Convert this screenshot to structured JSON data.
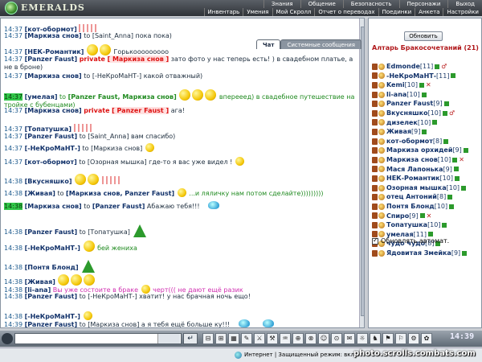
{
  "app": {
    "logo_text": "EMERALDS"
  },
  "nav": {
    "row1": [
      "Знания",
      "Общение",
      "Безопасность",
      "Персонажи",
      "Выход"
    ],
    "row2": [
      "Инвентарь",
      "Умения",
      "Мой Скролл",
      "Отчет о переводах",
      "Поединки",
      "Анкета",
      "Настройки"
    ]
  },
  "tabs": [
    {
      "label": "Чат",
      "active": true
    },
    {
      "label": "Системные сообщения",
      "active": false
    }
  ],
  "messages": [
    {
      "time": "14:37",
      "nick": "[кот-обормот]",
      "text": ""
    },
    {
      "time": "14:37",
      "nick": "[Маркиза снов]",
      "to_prefix": "to",
      "to": "[Saint_Anna]",
      "text": "пока пока)"
    },
    {
      "time": "14:37",
      "nick": "[НЕК-Романтик]",
      "text": "Горькооооооооо"
    },
    {
      "time": "14:37",
      "nick": "[Panzer Faust]",
      "priv": "private",
      "privnick": "[ Маркиза снов ]",
      "text": "зато фото у нас теперь есть! ) в свадебном платье, а не в броне)"
    },
    {
      "time": "14:37",
      "nick": "[Маркиза снов]",
      "to_prefix": "to",
      "to": "[-НеКроМаНТ-]",
      "text": "какой отважный)"
    },
    {
      "time": "14:37",
      "nick": "[умелая]",
      "to_prefix": "to",
      "to": "[Panzer Faust, Маркиза снов]",
      "text": "вперееед) в свадебное путешествие на тройке с бубенцами)"
    },
    {
      "time": "14:37",
      "nick": "[Маркиза снов]",
      "priv": "private",
      "privnick": "[ Panzer Faust ]",
      "text": "ага!"
    },
    {
      "time": "14:37",
      "nick": "[Топатушка]",
      "text": ""
    },
    {
      "time": "14:37",
      "nick": "[Panzer Faust]",
      "to_prefix": "to",
      "to": "[Saint_Anna]",
      "text": "вам спасибо)"
    },
    {
      "time": "14:37",
      "nick": "[-НеКроМаНТ-]",
      "to_prefix": "to",
      "to": "[Маркиза снов]",
      "text": ""
    },
    {
      "time": "14:37",
      "nick": "[кот-обормот]",
      "to_prefix": "to",
      "to": "[Озорная мышка]",
      "text": "где-то я вас уже видел !"
    },
    {
      "time": "14:38",
      "nick": "[Вкусняшко]",
      "text": ""
    },
    {
      "time": "14:38",
      "nick": "[Живая]",
      "to_prefix": "to",
      "to": "[Маркиза снов, Panzer Faust]",
      "text": "...и ляличку нам потом сделайте)))))))))"
    },
    {
      "time": "14:38",
      "nick": "[Маркиза снов]",
      "to_prefix": "to",
      "to": "[Panzer Faust]",
      "text": "Абажаю тебя!!!"
    },
    {
      "time": "14:38",
      "nick": "[Panzer Faust]",
      "to_prefix": "to",
      "to": "[Топатушка]",
      "text": ""
    },
    {
      "time": "14:38",
      "nick": "[-НеКроМаНТ-]",
      "text": "бей жениха"
    },
    {
      "time": "14:38",
      "nick": "[Понтя Блонд]",
      "text": ""
    },
    {
      "time": "14:38",
      "nick": "[Живая]",
      "text": ""
    },
    {
      "time": "14:38",
      "nick": "[li-ana]",
      "text": "Вы уже состоите в браке",
      "text2": "черт((( не дают ещё разик"
    },
    {
      "time": "14:38",
      "nick": "[Panzer Faust]",
      "to_prefix": "to",
      "to": "[-НеКроМаНТ-]",
      "text": "хватит! у нас брачная ночь ещо!"
    },
    {
      "time": "14:38",
      "nick": "[-НеКроМаНТ-]",
      "text": ""
    },
    {
      "time": "14:39",
      "nick": "[Panzer Faust]",
      "to_prefix": "to",
      "to": "[Маркиза снов]",
      "text": "а я тебя ещё больше ку!!!"
    }
  ],
  "sidebar": {
    "refresh_label": "Обновить",
    "room_title": "Алтарь Бракосочетаний (21)",
    "users": [
      {
        "name": "Edmonde",
        "level": "[11]",
        "mark": "♂"
      },
      {
        "name": "-НеКроМаНТ-",
        "level": "[11]",
        "mark": ""
      },
      {
        "name": "Kemi",
        "level": "[10]",
        "mark": "✕"
      },
      {
        "name": "li-ana",
        "level": "[10]",
        "mark": ""
      },
      {
        "name": "Panzer Faust",
        "level": "[9]",
        "mark": ""
      },
      {
        "name": "Вкусняшко",
        "level": "[10]",
        "mark": "♂"
      },
      {
        "name": "дизелек",
        "level": "[10]",
        "mark": ""
      },
      {
        "name": "Живая",
        "level": "[9]",
        "mark": ""
      },
      {
        "name": "кот-обормот",
        "level": "[8]",
        "mark": ""
      },
      {
        "name": "Маркиза орхидей",
        "level": "[9]",
        "mark": ""
      },
      {
        "name": "Маркиза снов",
        "level": "[10]",
        "mark": "✕"
      },
      {
        "name": "Мася Лапонька",
        "level": "[9]",
        "mark": ""
      },
      {
        "name": "НЕК-Романтик",
        "level": "[10]",
        "mark": ""
      },
      {
        "name": "Озорная мышка",
        "level": "[10]",
        "mark": ""
      },
      {
        "name": "отец Антоний",
        "level": "[8]",
        "mark": ""
      },
      {
        "name": "Понтя Блонд",
        "level": "[10]",
        "mark": ""
      },
      {
        "name": "Спиро",
        "level": "[9]",
        "mark": "✕"
      },
      {
        "name": "Топатушка",
        "level": "[10]",
        "mark": ""
      },
      {
        "name": "умелая",
        "level": "[11]",
        "mark": ""
      },
      {
        "name": "чудо чудо",
        "level": "[8]",
        "mark": ""
      },
      {
        "name": "Ядовитая Змейка",
        "level": "[9]",
        "mark": ""
      }
    ],
    "auto_update_label": "Обновлять автомат."
  },
  "toolbar": {
    "send_icon": "↵",
    "icons": [
      "⊟",
      "⊞",
      "▦",
      "✎",
      "⚔",
      "⚒",
      "♒",
      "⊕",
      "⊗",
      "☺",
      "⊙",
      "✉",
      "☼",
      "♞",
      "⚑",
      "⚐",
      "⚙",
      "✿"
    ],
    "clock": "14:39"
  },
  "statusbar": {
    "zone_text": "Интернет | Защищенный режим: вкл."
  },
  "watermark": "photo.scrolls.combats.com"
}
